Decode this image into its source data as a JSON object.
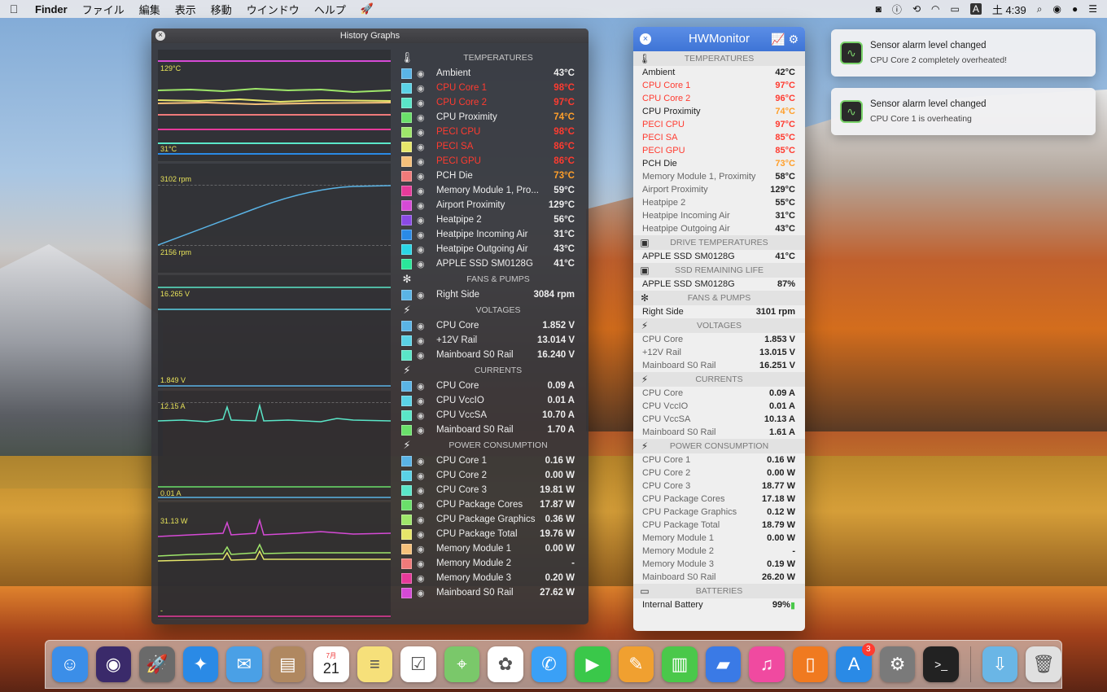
{
  "menubar": {
    "app": "Finder",
    "items": [
      "ファイル",
      "編集",
      "表示",
      "移動",
      "ウインドウ",
      "ヘルプ"
    ],
    "input_source": "A",
    "date": "土 4:39"
  },
  "history": {
    "title": "History Graphs",
    "graph_labels": [
      "129°C",
      "31°C",
      "3102 rpm",
      "2156 rpm",
      "16.265 V",
      "1.849 V",
      "12.15 A",
      "0.01 A",
      "31.13 W",
      "-"
    ],
    "sections": [
      {
        "title": "TEMPERATURES",
        "icon": "thermometer-icon",
        "rows": [
          {
            "name": "Ambient",
            "value": "43°C",
            "color": "#5ab4e6",
            "val_class": ""
          },
          {
            "name": "CPU Core 1",
            "value": "98°C",
            "color": "#5ad2e6",
            "val_class": "red",
            "name_class": "red"
          },
          {
            "name": "CPU Core 2",
            "value": "97°C",
            "color": "#5ae6c8",
            "val_class": "red",
            "name_class": "red"
          },
          {
            "name": "CPU Proximity",
            "value": "74°C",
            "color": "#6ae06a",
            "val_class": "orange"
          },
          {
            "name": "PECI CPU",
            "value": "98°C",
            "color": "#9ee66a",
            "val_class": "red",
            "name_class": "red"
          },
          {
            "name": "PECI SA",
            "value": "86°C",
            "color": "#e6e66a",
            "val_class": "red",
            "name_class": "red"
          },
          {
            "name": "PECI GPU",
            "value": "86°C",
            "color": "#f5c07a",
            "val_class": "red",
            "name_class": "red"
          },
          {
            "name": "PCH Die",
            "value": "73°C",
            "color": "#f07a7a",
            "val_class": "orange"
          },
          {
            "name": "Memory Module 1, Pro...",
            "value": "59°C",
            "color": "#e63a9a",
            "val_class": ""
          },
          {
            "name": "Airport Proximity",
            "value": "129°C",
            "color": "#d64ad6",
            "val_class": ""
          },
          {
            "name": "Heatpipe 2",
            "value": "56°C",
            "color": "#8a4ae6",
            "val_class": ""
          },
          {
            "name": "Heatpipe Incoming Air",
            "value": "31°C",
            "color": "#2a8ae6",
            "val_class": ""
          },
          {
            "name": "Heatpipe Outgoing Air",
            "value": "43°C",
            "color": "#2ad6e6",
            "val_class": ""
          },
          {
            "name": "APPLE SSD SM0128G",
            "value": "41°C",
            "color": "#2ae69a",
            "val_class": ""
          }
        ]
      },
      {
        "title": "FANS & PUMPS",
        "icon": "fan-icon",
        "rows": [
          {
            "name": "Right Side",
            "value": "3084 rpm",
            "color": "#5ab4e6",
            "val_class": ""
          }
        ]
      },
      {
        "title": "VOLTAGES",
        "icon": "bolt-icon",
        "rows": [
          {
            "name": "CPU Core",
            "value": "1.852 V",
            "color": "#5ab4e6",
            "val_class": ""
          },
          {
            "name": "+12V Rail",
            "value": "13.014 V",
            "color": "#5ad2e6",
            "val_class": ""
          },
          {
            "name": "Mainboard S0 Rail",
            "value": "16.240 V",
            "color": "#5ae6c8",
            "val_class": ""
          }
        ]
      },
      {
        "title": "CURRENTS",
        "icon": "bolt-icon",
        "rows": [
          {
            "name": "CPU Core",
            "value": "0.09 A",
            "color": "#5ab4e6",
            "val_class": ""
          },
          {
            "name": "CPU VccIO",
            "value": "0.01 A",
            "color": "#5ad2e6",
            "val_class": ""
          },
          {
            "name": "CPU VccSA",
            "value": "10.70 A",
            "color": "#5ae6c8",
            "val_class": ""
          },
          {
            "name": "Mainboard S0 Rail",
            "value": "1.70 A",
            "color": "#6ae06a",
            "val_class": ""
          }
        ]
      },
      {
        "title": "POWER CONSUMPTION",
        "icon": "bolt-icon",
        "rows": [
          {
            "name": "CPU Core 1",
            "value": "0.16 W",
            "color": "#5ab4e6",
            "val_class": ""
          },
          {
            "name": "CPU Core 2",
            "value": "0.00 W",
            "color": "#5ad2e6",
            "val_class": ""
          },
          {
            "name": "CPU Core 3",
            "value": "19.81 W",
            "color": "#5ae6c8",
            "val_class": ""
          },
          {
            "name": "CPU Package Cores",
            "value": "17.87 W",
            "color": "#6ae06a",
            "val_class": ""
          },
          {
            "name": "CPU Package Graphics",
            "value": "0.36 W",
            "color": "#9ee66a",
            "val_class": ""
          },
          {
            "name": "CPU Package Total",
            "value": "19.76 W",
            "color": "#e6e66a",
            "val_class": ""
          },
          {
            "name": "Memory Module 1",
            "value": "0.00 W",
            "color": "#f5c07a",
            "val_class": ""
          },
          {
            "name": "Memory Module 2",
            "value": "-",
            "color": "#f07a7a",
            "val_class": ""
          },
          {
            "name": "Memory Module 3",
            "value": "0.20 W",
            "color": "#e63a9a",
            "val_class": ""
          },
          {
            "name": "Mainboard S0 Rail",
            "value": "27.62 W",
            "color": "#d64ad6",
            "val_class": ""
          }
        ]
      }
    ]
  },
  "hwmonitor": {
    "title": "HWMonitor",
    "sections": [
      {
        "title": "TEMPERATURES",
        "icon": "thermometer-icon",
        "rows": [
          {
            "name": "Ambient",
            "value": "42°C"
          },
          {
            "name": "CPU Core 1",
            "value": "97°C",
            "cls": "red"
          },
          {
            "name": "CPU Core 2",
            "value": "96°C",
            "cls": "red"
          },
          {
            "name": "CPU Proximity",
            "value": "74°C",
            "cls": "orange"
          },
          {
            "name": "PECI CPU",
            "value": "97°C",
            "cls": "red"
          },
          {
            "name": "PECI SA",
            "value": "85°C",
            "cls": "red"
          },
          {
            "name": "PECI GPU",
            "value": "85°C",
            "cls": "red"
          },
          {
            "name": "PCH Die",
            "value": "73°C",
            "cls": "orange"
          },
          {
            "name": "Memory Module 1, Proximity",
            "value": "58°C",
            "cls": "dim"
          },
          {
            "name": "Airport Proximity",
            "value": "129°C",
            "cls": "dim"
          },
          {
            "name": "Heatpipe 2",
            "value": "55°C",
            "cls": "dim"
          },
          {
            "name": "Heatpipe Incoming Air",
            "value": "31°C",
            "cls": "dim"
          },
          {
            "name": "Heatpipe Outgoing Air",
            "value": "43°C",
            "cls": "dim"
          }
        ]
      },
      {
        "title": "DRIVE TEMPERATURES",
        "icon": "drive-icon",
        "rows": [
          {
            "name": "APPLE SSD SM0128G",
            "value": "41°C"
          }
        ]
      },
      {
        "title": "SSD REMAINING LIFE",
        "icon": "drive-icon",
        "rows": [
          {
            "name": "APPLE SSD SM0128G",
            "value": "87%"
          }
        ]
      },
      {
        "title": "FANS & PUMPS",
        "icon": "fan-icon",
        "rows": [
          {
            "name": "Right Side",
            "value": "3101 rpm"
          }
        ]
      },
      {
        "title": "VOLTAGES",
        "icon": "bolt-icon",
        "rows": [
          {
            "name": "CPU Core",
            "value": "1.853 V",
            "cls": "dim"
          },
          {
            "name": "+12V Rail",
            "value": "13.015 V",
            "cls": "dim"
          },
          {
            "name": "Mainboard S0 Rail",
            "value": "16.251 V",
            "cls": "dim"
          }
        ]
      },
      {
        "title": "CURRENTS",
        "icon": "bolt-icon",
        "rows": [
          {
            "name": "CPU Core",
            "value": "0.09 A",
            "cls": "dim"
          },
          {
            "name": "CPU VccIO",
            "value": "0.01 A",
            "cls": "dim"
          },
          {
            "name": "CPU VccSA",
            "value": "10.13 A",
            "cls": "dim"
          },
          {
            "name": "Mainboard S0 Rail",
            "value": "1.61 A",
            "cls": "dim"
          }
        ]
      },
      {
        "title": "POWER CONSUMPTION",
        "icon": "bolt-icon",
        "rows": [
          {
            "name": "CPU Core 1",
            "value": "0.16 W",
            "cls": "dim"
          },
          {
            "name": "CPU Core 2",
            "value": "0.00 W",
            "cls": "dim"
          },
          {
            "name": "CPU Core 3",
            "value": "18.77 W",
            "cls": "dim"
          },
          {
            "name": "CPU Package Cores",
            "value": "17.18 W",
            "cls": "dim"
          },
          {
            "name": "CPU Package Graphics",
            "value": "0.12 W",
            "cls": "dim"
          },
          {
            "name": "CPU Package Total",
            "value": "18.79 W",
            "cls": "dim"
          },
          {
            "name": "Memory Module 1",
            "value": "0.00 W",
            "cls": "dim"
          },
          {
            "name": "Memory Module 2",
            "value": "-",
            "cls": "dim"
          },
          {
            "name": "Memory Module 3",
            "value": "0.19 W",
            "cls": "dim"
          },
          {
            "name": "Mainboard S0 Rail",
            "value": "26.20 W",
            "cls": "dim"
          }
        ]
      },
      {
        "title": "BATTERIES",
        "icon": "battery-icon",
        "rows": [
          {
            "name": "Internal Battery",
            "value": "99%"
          }
        ]
      }
    ]
  },
  "notifications": [
    {
      "title": "Sensor alarm level changed",
      "body": "CPU Core 2 completely overheated!"
    },
    {
      "title": "Sensor alarm level changed",
      "body": "CPU Core 1 is overheating"
    }
  ],
  "dock": {
    "calendar_month": "7月",
    "calendar_day": "21",
    "appstore_badge": "3",
    "icons": [
      {
        "name": "finder",
        "color": "#3b8ee8"
      },
      {
        "name": "siri",
        "color": "#3a2a6a"
      },
      {
        "name": "launchpad",
        "color": "#6a6a6a"
      },
      {
        "name": "safari",
        "color": "#2a8ae6"
      },
      {
        "name": "mail",
        "color": "#4aa0e6"
      },
      {
        "name": "contacts",
        "color": "#b08860"
      },
      {
        "name": "calendar",
        "color": "#ffffff"
      },
      {
        "name": "notes",
        "color": "#f6e07a"
      },
      {
        "name": "reminders",
        "color": "#ffffff"
      },
      {
        "name": "maps",
        "color": "#7ac86a"
      },
      {
        "name": "photos",
        "color": "#ffffff"
      },
      {
        "name": "messages",
        "color": "#3aa0f6"
      },
      {
        "name": "facetime",
        "color": "#3ac84a"
      },
      {
        "name": "pages",
        "color": "#f0a030"
      },
      {
        "name": "numbers",
        "color": "#4ac84a"
      },
      {
        "name": "keynote",
        "color": "#3a7ae6"
      },
      {
        "name": "itunes",
        "color": "#f04aa0"
      },
      {
        "name": "ibooks",
        "color": "#f07a20"
      },
      {
        "name": "appstore",
        "color": "#2a8ae6"
      },
      {
        "name": "system-preferences",
        "color": "#7a7a7a"
      },
      {
        "name": "terminal",
        "color": "#222222"
      },
      {
        "name": "downloads-folder",
        "color": "#6ab6e6"
      },
      {
        "name": "trash",
        "color": "#e0e0e0"
      }
    ]
  }
}
